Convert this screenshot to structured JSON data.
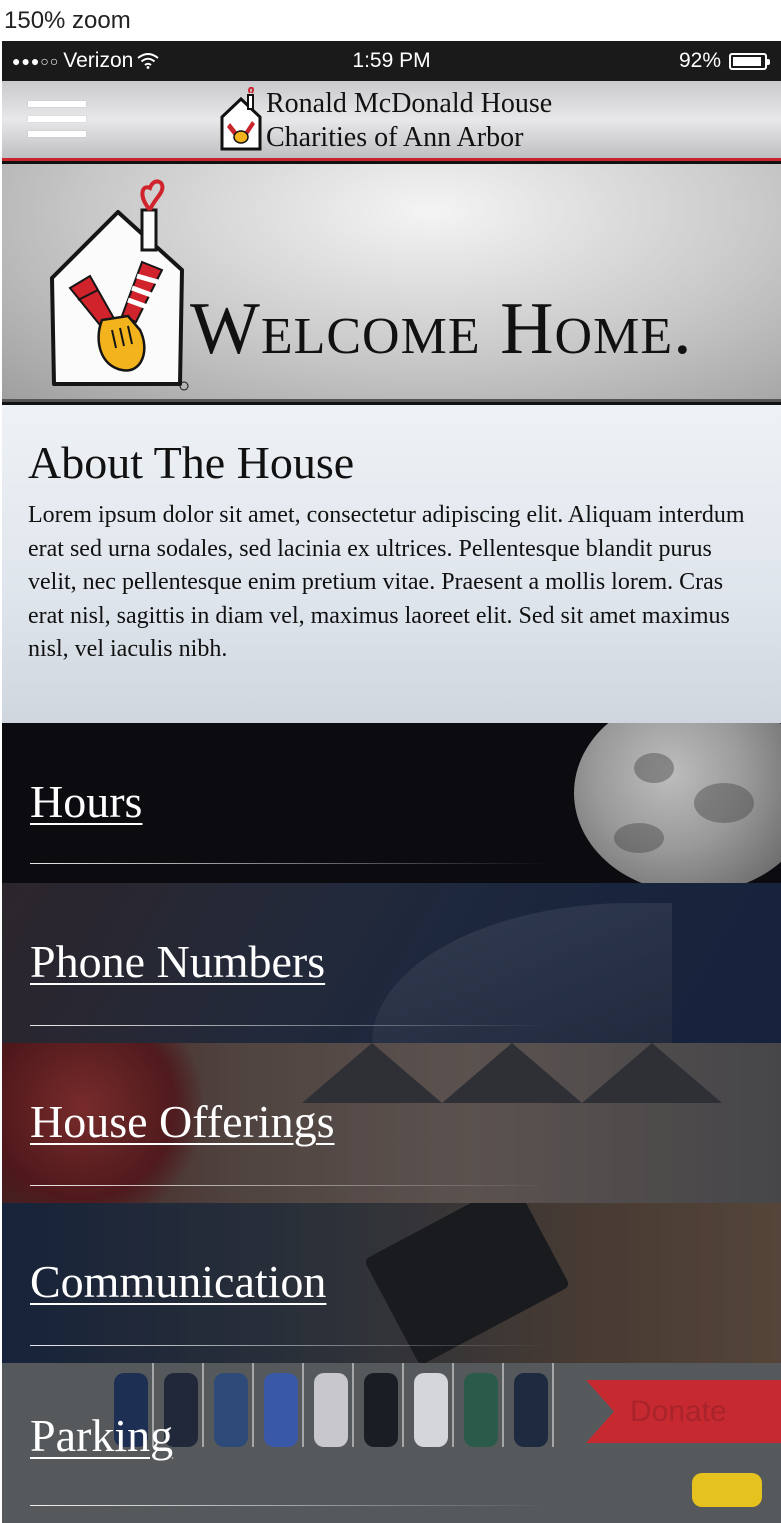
{
  "zoom_label": "150% zoom",
  "status_bar": {
    "signal": "●●●○○",
    "carrier": "Verizon",
    "time": "1:59 PM",
    "battery_text": "92%",
    "battery_level": 0.92
  },
  "nav": {
    "title_line1": "Ronald McDonald House",
    "title_line2": "Charities of Ann Arbor"
  },
  "hero": {
    "title": "Welcome Home."
  },
  "about": {
    "title": "About The House",
    "body": "Lorem ipsum dolor sit amet, consectetur adipiscing elit. Aliquam interdum erat sed urna sodales, sed lacinia ex ultrices. Pellentesque blandit purus velit, nec pellentesque enim pretium vitae. Praesent a mollis lorem. Cras erat nisl, sagittis in diam vel, maximus laoreet elit. Sed sit amet maximus nisl, vel iaculis nibh."
  },
  "menu": {
    "hours": "Hours",
    "phone_numbers": "Phone Numbers",
    "house_offerings": "House Offerings",
    "communication": "Communication",
    "parking": "Parking"
  },
  "donate": {
    "label": "Donate"
  },
  "colors": {
    "accent_red": "#c9252c",
    "donate_red": "#d7222b"
  }
}
